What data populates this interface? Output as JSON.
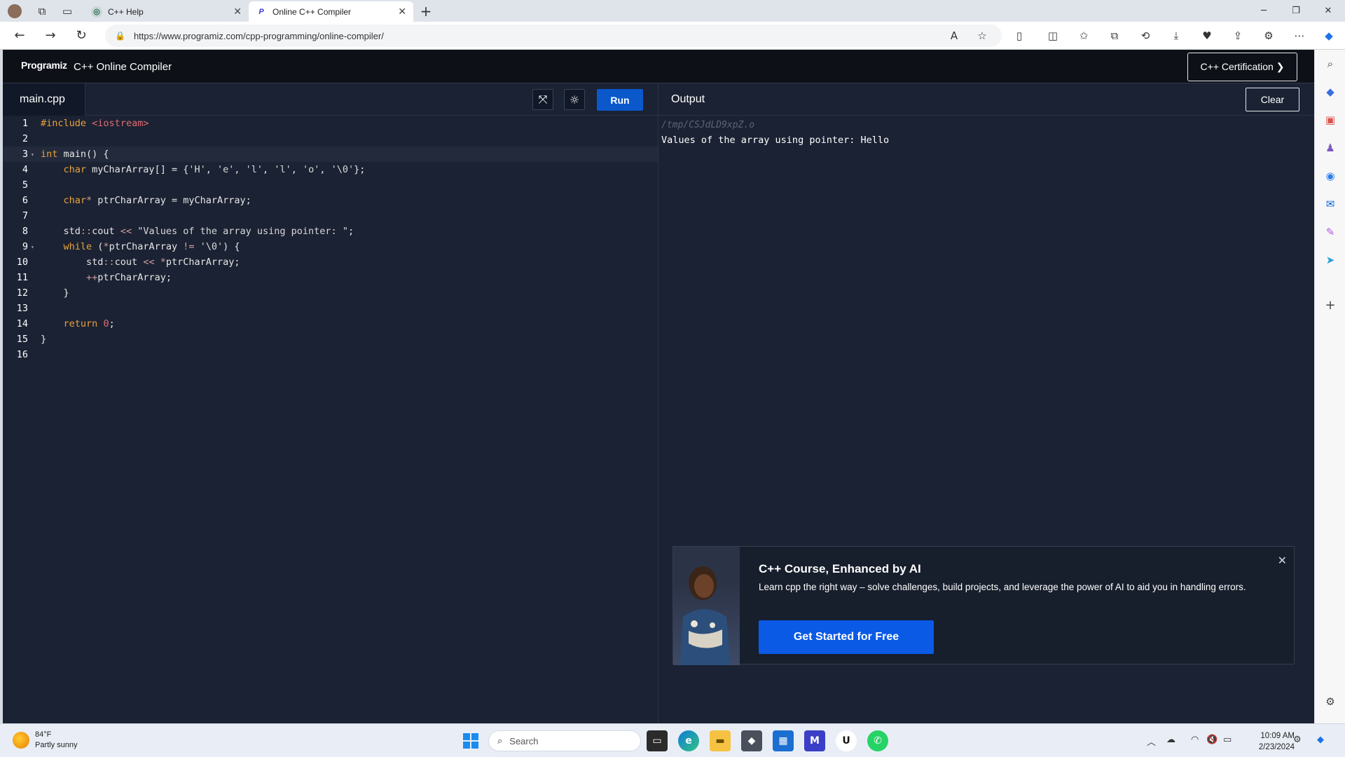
{
  "browser": {
    "tabs": [
      {
        "label": "C++ Help",
        "active": false
      },
      {
        "label": "Online C++ Compiler",
        "active": true
      }
    ],
    "url": "https://www.programiz.com/cpp-programming/online-compiler/"
  },
  "site": {
    "logo": "Programiz",
    "title": "C++ Online Compiler",
    "cert_button": "C++ Certification ❯"
  },
  "editor": {
    "file_tab": "main.cpp",
    "run_label": "Run",
    "lines": [
      {
        "n": "1",
        "code": "#include <iostream>"
      },
      {
        "n": "2",
        "code": ""
      },
      {
        "n": "3",
        "code": "int main() {"
      },
      {
        "n": "4",
        "code": "    char myCharArray[] = {'H', 'e', 'l', 'l', 'o', '\\0'};"
      },
      {
        "n": "5",
        "code": ""
      },
      {
        "n": "6",
        "code": "    char* ptrCharArray = myCharArray;"
      },
      {
        "n": "7",
        "code": ""
      },
      {
        "n": "8",
        "code": "    std::cout << \"Values of the array using pointer: \";"
      },
      {
        "n": "9",
        "code": "    while (*ptrCharArray != '\\0') {"
      },
      {
        "n": "10",
        "code": "        std::cout << *ptrCharArray;"
      },
      {
        "n": "11",
        "code": "        ++ptrCharArray;"
      },
      {
        "n": "12",
        "code": "    }"
      },
      {
        "n": "13",
        "code": ""
      },
      {
        "n": "14",
        "code": "    return 0;"
      },
      {
        "n": "15",
        "code": "}"
      },
      {
        "n": "16",
        "code": ""
      }
    ]
  },
  "output": {
    "title": "Output",
    "clear_label": "Clear",
    "path": "/tmp/CSJdLD9xpZ.o",
    "text": "Values of the array using pointer: Hello"
  },
  "promo": {
    "title": "C++ Course, Enhanced by AI",
    "description": "Learn cpp the right way – solve challenges, build projects, and leverage the power of AI to aid you in handling errors.",
    "button": "Get Started for Free"
  },
  "taskbar": {
    "temperature": "84°F",
    "weather": "Partly sunny",
    "search_placeholder": "Search",
    "time": "10:09 AM",
    "date": "2/23/2024"
  },
  "colors": {
    "accent": "#0a58ca",
    "editor_bg": "#1b2233",
    "header_bg": "#0d1117"
  }
}
